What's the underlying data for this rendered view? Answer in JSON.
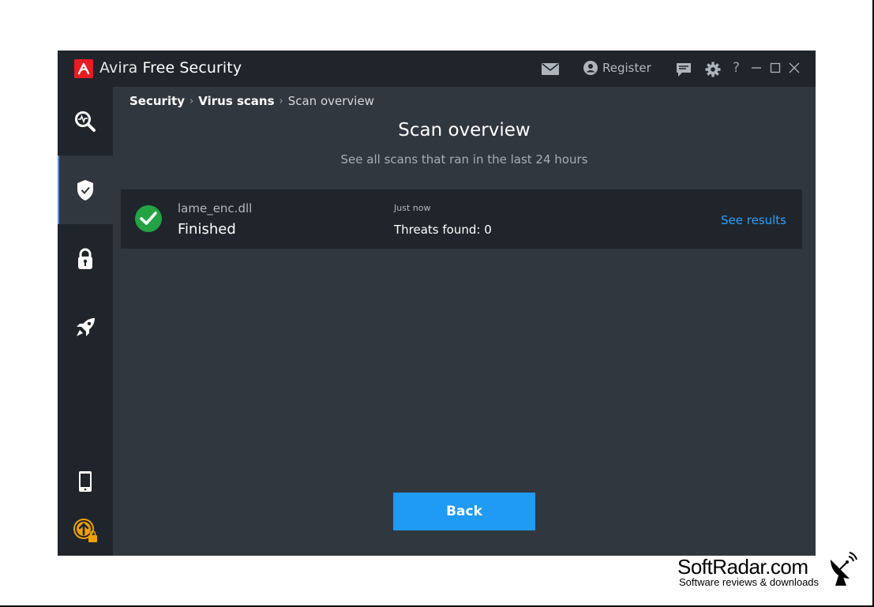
{
  "window": {
    "brand": "Avira",
    "product": "Free Security"
  },
  "titlebar": {
    "register_label": "Register",
    "help_label": "?"
  },
  "breadcrumb": {
    "items": [
      "Security",
      "Virus scans",
      "Scan overview"
    ]
  },
  "page": {
    "title": "Scan overview",
    "subtitle": "See all scans that ran in the last 24 hours"
  },
  "scans": [
    {
      "file": "lame_enc.dll",
      "status": "Finished",
      "time": "Just now",
      "threats": "Threats found: 0",
      "action": "See results"
    }
  ],
  "back_label": "Back",
  "sidebar": {
    "items": [
      "scan-icon",
      "shield-icon",
      "lock-icon",
      "rocket-icon",
      "mobile-icon",
      "upgrade-icon"
    ]
  },
  "watermark": {
    "name": "SoftRadar.com",
    "tagline": "Software reviews & downloads"
  },
  "colors": {
    "accent": "#1f9af5",
    "link": "#2ea0ff",
    "success": "#23a344",
    "brand_red": "#e61d22"
  }
}
